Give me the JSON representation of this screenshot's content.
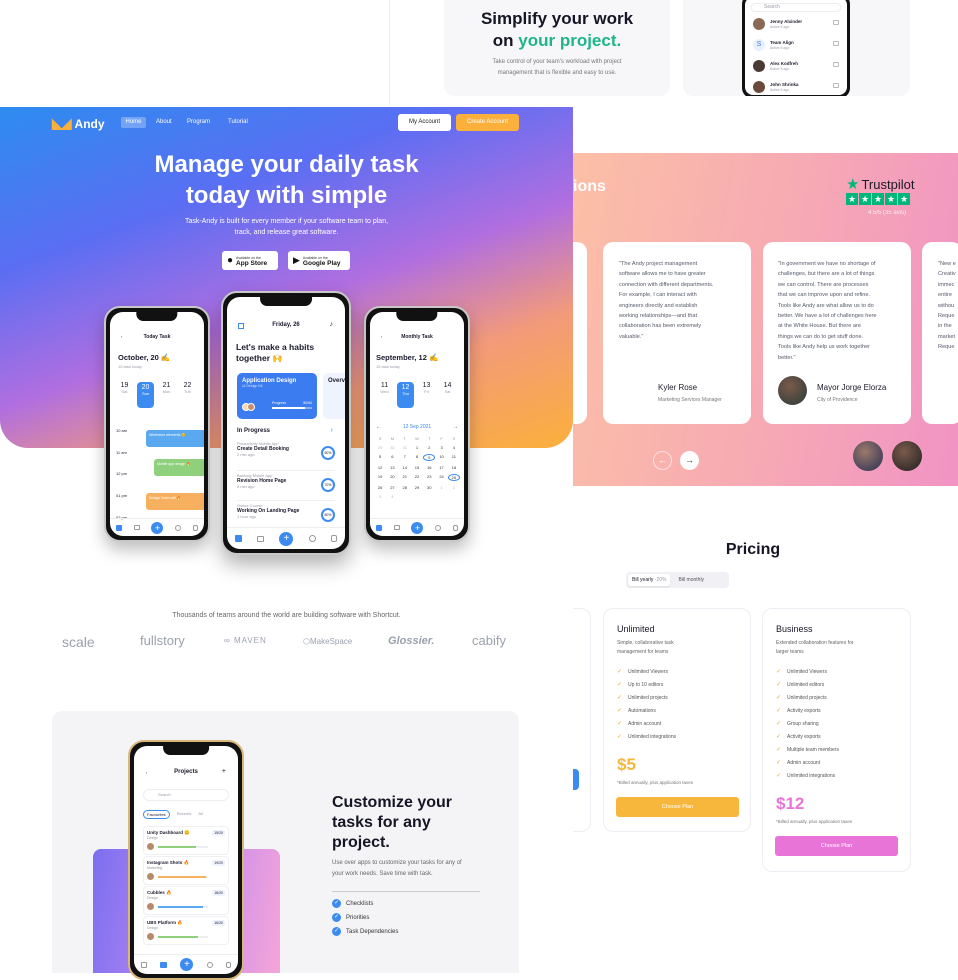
{
  "top": {
    "title_1": "Simplify your work",
    "title_2a": "on ",
    "title_2b": "your project.",
    "sub_1": "Take control of your team's workload with project",
    "sub_2": "management that is flexible and easy to use."
  },
  "contacts": {
    "search": "Search",
    "items": [
      {
        "name": "Jenny Alxinder",
        "sub": "Active 5 ago"
      },
      {
        "name": "Team Align",
        "sub": "Active 5 ago"
      },
      {
        "name": "Alex Kodfreh",
        "sub": "Active 5 ago"
      },
      {
        "name": "John Shrinka",
        "sub": "Active 5 ago"
      }
    ]
  },
  "nav": {
    "brand": "Andy",
    "links": [
      "Home",
      "About",
      "Program",
      "Tutorial"
    ],
    "my_account": "My Account",
    "create_account": "Create Account"
  },
  "hero": {
    "title_1": "Manage your daily task",
    "title_2": "today with simple",
    "sub_1": "Task-Andy is built for every member if your software team to plan,",
    "sub_2": "track, and release great software.",
    "appstore_small": "Available on the",
    "appstore": "App Store",
    "play_small": "Available on the",
    "play": "Google Play"
  },
  "phone_left": {
    "title": "Today Task",
    "date": "October, 20 ✍",
    "count": "15 task today",
    "days": [
      {
        "n": "19",
        "d": "Sat"
      },
      {
        "n": "20",
        "d": "Sun"
      },
      {
        "n": "21",
        "d": "Mon"
      },
      {
        "n": "22",
        "d": "Tue"
      }
    ],
    "times": [
      "10 am",
      "11 am",
      "12 pm",
      "01 pm",
      "02 pm"
    ],
    "events": [
      "Wireframe elements 😊",
      "Mobile app design 🔥",
      "Design Team call 🔥"
    ]
  },
  "phone_mid": {
    "date": "Friday, 26",
    "title": "Let's make a habits together 🙌",
    "card_title": "Application Design",
    "card_sub": "UI Design Kit",
    "progress": "Progress",
    "progress_val": "50/60",
    "card2": "Overview",
    "section": "In Progress",
    "tasks": [
      {
        "cat": "Productivity Mobile App",
        "name": "Create Detail Booking",
        "time": "2 min ago",
        "pct": "60%"
      },
      {
        "cat": "Banking Mobile App",
        "name": "Revision Home Page",
        "time": "5 min ago",
        "pct": "70%"
      },
      {
        "cat": "Online Course",
        "name": "Working On Landing Page",
        "time": "1 hour ago",
        "pct": "80%"
      }
    ]
  },
  "phone_right": {
    "title": "Monthly Task",
    "date": "September, 12 ✍",
    "count": "15 task today",
    "days": [
      {
        "n": "11",
        "d": "Wed"
      },
      {
        "n": "12",
        "d": "Thu"
      },
      {
        "n": "13",
        "d": "Fri"
      },
      {
        "n": "14",
        "d": "Sat"
      }
    ],
    "month": "12 Sep 2021",
    "dow": [
      "S",
      "M",
      "T",
      "W",
      "T",
      "F",
      "S"
    ],
    "cal": [
      "29",
      "30",
      "31",
      "1",
      "2",
      "3",
      "4",
      "5",
      "6",
      "7",
      "8",
      "9",
      "10",
      "11",
      "12",
      "13",
      "14",
      "15",
      "16",
      "17",
      "18",
      "19",
      "20",
      "21",
      "22",
      "23",
      "24",
      "25",
      "26",
      "27",
      "28",
      "29",
      "30",
      "1",
      "2",
      "3",
      "4"
    ]
  },
  "logos": {
    "caption": "Thousands of teams around the world are building software with Shortcut.",
    "items": [
      "scale",
      "fullstory",
      "MAVEN",
      "MakeSpace",
      "Glossier.",
      "cabify"
    ]
  },
  "custom": {
    "title_1": "Customize your",
    "title_2": "tasks for any",
    "title_3": "project.",
    "sub_1": "Use over apps to customize your tasks for any of",
    "sub_2": "your work needs. Save time with task.",
    "features": [
      "Checklists",
      "Priorities",
      "Task Dependencies"
    ]
  },
  "projects": {
    "title": "Projects",
    "search": "Search",
    "tabs": [
      "Favourites",
      "Recents",
      "All"
    ],
    "items": [
      {
        "name": "Unity Dashboard 😊",
        "cat": "Design",
        "val": "15/20"
      },
      {
        "name": "Instagram Shots 🔥",
        "cat": "Marketing",
        "val": "19/20"
      },
      {
        "name": "Cubbles 🔥",
        "cat": "Design",
        "val": "18/20"
      },
      {
        "name": "UBS Platform 🔥",
        "cat": "Design",
        "val": "16/20"
      }
    ]
  },
  "testimonials": {
    "heading_fragment": "ions",
    "trustpilot": "Trustpilot",
    "rating": "4.5/5 (35 avis)",
    "cards": [
      {
        "lines": [
          "\"The Andy project management",
          "software allows me to have greater",
          "connection with different departments.",
          "For example, I can interact with",
          "engineers directly and establish",
          "working relationships—and that",
          "collaboration has been extremely",
          "valuable.\""
        ],
        "name": "Kyler Rose",
        "role": "Marketing Services Manager"
      },
      {
        "lines": [
          "\"In government we have no shortage of",
          "challenges, but there are a lot of things",
          "we can control. There are processes",
          "that we can improve upon and refine.",
          "Tools like Andy are what allow us to do",
          "better. We have a lot of challenges here",
          "at the White House. But there are",
          "things we can do to get stuff done.",
          "Tools like Andy help us work together",
          "better.\""
        ],
        "name": "Mayor Jorge Elorza",
        "role": "City of Providence"
      }
    ],
    "partial": [
      "\"New e",
      "Creativ",
      "immec",
      "entire",
      "withou",
      "Reque",
      "in the",
      "market",
      "Reque"
    ]
  },
  "pricing": {
    "title": "Pricing",
    "toggle_yearly": "Bill yearly",
    "toggle_badge": "-20%",
    "toggle_monthly": "Bill monthly",
    "plans": [
      {
        "name": "Unlimited",
        "desc_1": "Simple, collaborative task",
        "desc_2": "management for teams",
        "features": [
          "Unlimited Viewers",
          "Up to 10 editors",
          "Unlimited projects",
          "Automations",
          "Admin account",
          "Unlimited integrations"
        ],
        "price": "$5",
        "note": "*Billed annually, plus application taxes",
        "cta": "Choose Plan",
        "color": "#f6b73c"
      },
      {
        "name": "Business",
        "desc_1": "Extended collaboration features for",
        "desc_2": "larger teams",
        "features": [
          "Unlimited Viewers",
          "Unlimited editors",
          "Unlimited projects",
          "Activity exports",
          "Group sharing",
          "Activity exports",
          "Multiple team members",
          "Admin account",
          "Unlimited integrations"
        ],
        "price": "$12",
        "note": "*Billed annually, plus application taxes",
        "cta": "Choose Plan",
        "color": "#e874d8"
      }
    ]
  }
}
